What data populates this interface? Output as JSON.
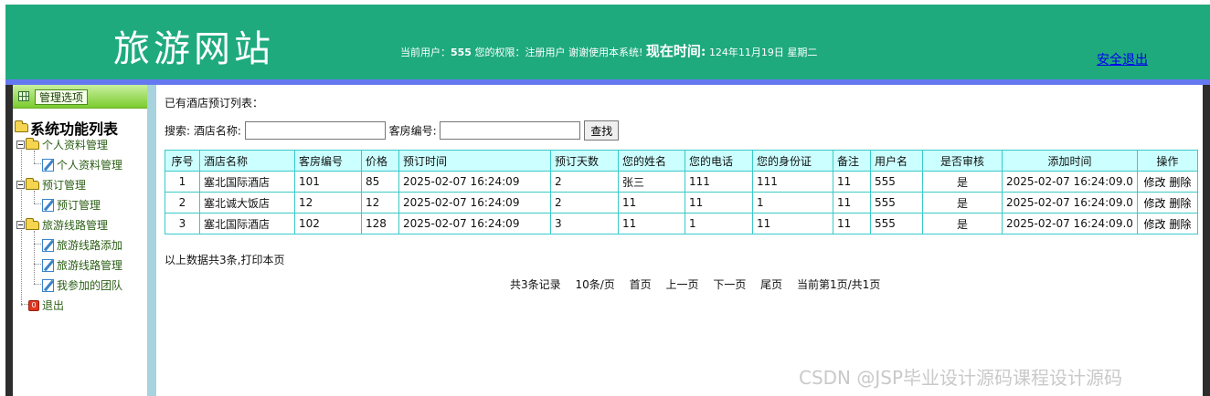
{
  "header": {
    "site_title": "旅游网站",
    "current_user_label": "当前用户：",
    "current_user": "555",
    "role_label": "您的权限：",
    "role": "注册用户",
    "thanks": "谢谢使用本系统!",
    "time_label": "现在时间:",
    "date": "124年11月19日",
    "weekday": "星期二",
    "logout": "安全退出"
  },
  "sidebar": {
    "tab_label": "管理选项",
    "root": "系统功能列表",
    "groups": [
      {
        "label": "个人资料管理",
        "items": [
          "个人资料管理"
        ]
      },
      {
        "label": "预订管理",
        "items": [
          "预订管理"
        ]
      },
      {
        "label": "旅游线路管理",
        "items": [
          "旅游线路添加",
          "旅游线路管理",
          "我参加的团队"
        ]
      }
    ],
    "exit": "退出"
  },
  "main": {
    "list_title": "已有酒店预订列表：",
    "search": {
      "label": "搜索:",
      "hotel_label": "酒店名称:",
      "hotel_value": "",
      "room_label": "客房编号:",
      "room_value": "",
      "button": "查找"
    },
    "table": {
      "headers": [
        "序号",
        "酒店名称",
        "客房编号",
        "价格",
        "预订时间",
        "预订天数",
        "您的姓名",
        "您的电话",
        "您的身份证",
        "备注",
        "用户名",
        "是否审核",
        "添加时间",
        "操作"
      ],
      "rows": [
        [
          "1",
          "塞北国际酒店",
          "101",
          "85",
          "2025-02-07 16:24:09",
          "2",
          "张三",
          "111",
          "111",
          "11",
          "555",
          "是",
          "2025-02-07 16:24:09.0"
        ],
        [
          "2",
          "塞北诚大饭店",
          "12",
          "12",
          "2025-02-07 16:24:09",
          "2",
          "11",
          "11",
          "1",
          "11",
          "555",
          "是",
          "2025-02-07 16:24:09.0"
        ],
        [
          "3",
          "塞北国际酒店",
          "102",
          "128",
          "2025-02-07 16:24:09",
          "3",
          "11",
          "1",
          "11",
          "11",
          "555",
          "是",
          "2025-02-07 16:24:09.0"
        ]
      ],
      "edit_label": "修改",
      "delete_label": "删除"
    },
    "summary": "以上数据共3条,打印本页",
    "pager": {
      "records": "共3条记录",
      "per_page": "10条/页",
      "first": "首页",
      "prev": "上一页",
      "next": "下一页",
      "last": "尾页",
      "current": "当前第1页/共1页"
    }
  },
  "watermark": "CSDN @JSP毕业设计源码课程设计源码",
  "colors": {
    "header_bg": "#1faa7e",
    "accent_bar": "#6479ef",
    "table_border": "#39c9c9",
    "table_header_bg": "#ccffff",
    "sidebar_text": "#2b5e14"
  }
}
